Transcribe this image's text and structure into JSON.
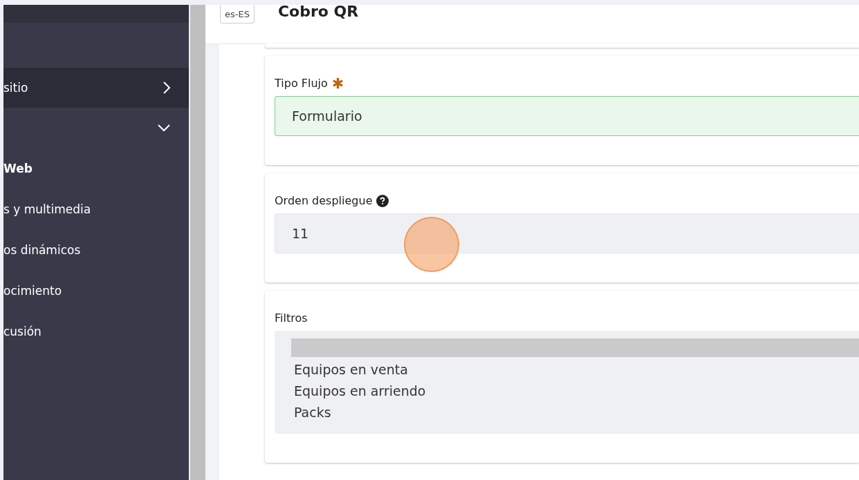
{
  "sidebar": {
    "items": [
      {
        "label": "sitio",
        "kind": "collapsed",
        "bold": false,
        "selected": true
      },
      {
        "kind": "expanded",
        "selected": false
      },
      {
        "label": "Web",
        "kind": "link",
        "bold": true,
        "selected": false
      },
      {
        "label": "s y multimedia",
        "kind": "link",
        "bold": false,
        "selected": false
      },
      {
        "label": "os dinámicos",
        "kind": "link",
        "bold": false,
        "selected": false
      },
      {
        "label": "ocimiento",
        "kind": "link",
        "bold": false,
        "selected": false
      },
      {
        "label": "cusión",
        "kind": "link",
        "bold": false,
        "selected": false
      }
    ]
  },
  "header": {
    "locale": "es-ES",
    "title": "Cobro QR"
  },
  "form": {
    "fields": [
      {
        "label": "Tipo Flujo",
        "required": true,
        "help": false,
        "kind": "valid",
        "value": "Formulario"
      },
      {
        "label": "Orden despliegue",
        "required": false,
        "help": true,
        "kind": "readonly",
        "value": "11"
      },
      {
        "label": "Filtros",
        "required": false,
        "help": false,
        "kind": "list",
        "options": [
          {
            "selected": true
          },
          {
            "label": "Equipos en venta",
            "selected": false
          },
          {
            "label": "Equipos en arriendo",
            "selected": false
          },
          {
            "label": "Packs",
            "selected": false
          }
        ]
      }
    ]
  }
}
